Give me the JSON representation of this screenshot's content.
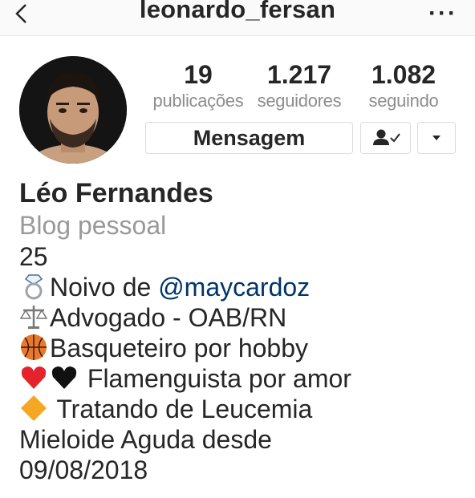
{
  "header": {
    "username": "leonardo_fersan",
    "back_icon": "chevron-left-icon",
    "more_icon": "more-horizontal-icon",
    "more_glyph": "···"
  },
  "profile": {
    "avatar_icon": "profile-photo",
    "stats": {
      "posts": {
        "value": "19",
        "label": "publicações"
      },
      "followers": {
        "value": "1.217",
        "label": "seguidores"
      },
      "following": {
        "value": "1.082",
        "label": "seguindo"
      }
    },
    "buttons": {
      "message_label": "Mensagem",
      "following_icon": "person-check-icon",
      "dropdown_icon": "caret-down-icon"
    },
    "full_name": "Léo Fernandes",
    "category": "Blog pessoal"
  },
  "bio": {
    "age": "25",
    "engaged_prefix": "Noivo de ",
    "engaged_mention": "@maycardoz",
    "lawyer": "Advogado - OAB/RN",
    "hobby": "Basqueteiro por hobby",
    "team": "Flamenguista por amor",
    "health_line1": "Tratando de Leucemia",
    "health_line2": "Mieloide Aguda desde",
    "health_line3": "09/08/2018",
    "emoji_icons": [
      "ring-icon",
      "scales-icon",
      "basketball-icon",
      "red-heart-icon",
      "black-heart-icon",
      "orange-diamond-icon"
    ]
  },
  "colors": {
    "text": "#262626",
    "muted": "#8e8e8e",
    "mention": "#003569",
    "border": "#dbdbdb"
  }
}
